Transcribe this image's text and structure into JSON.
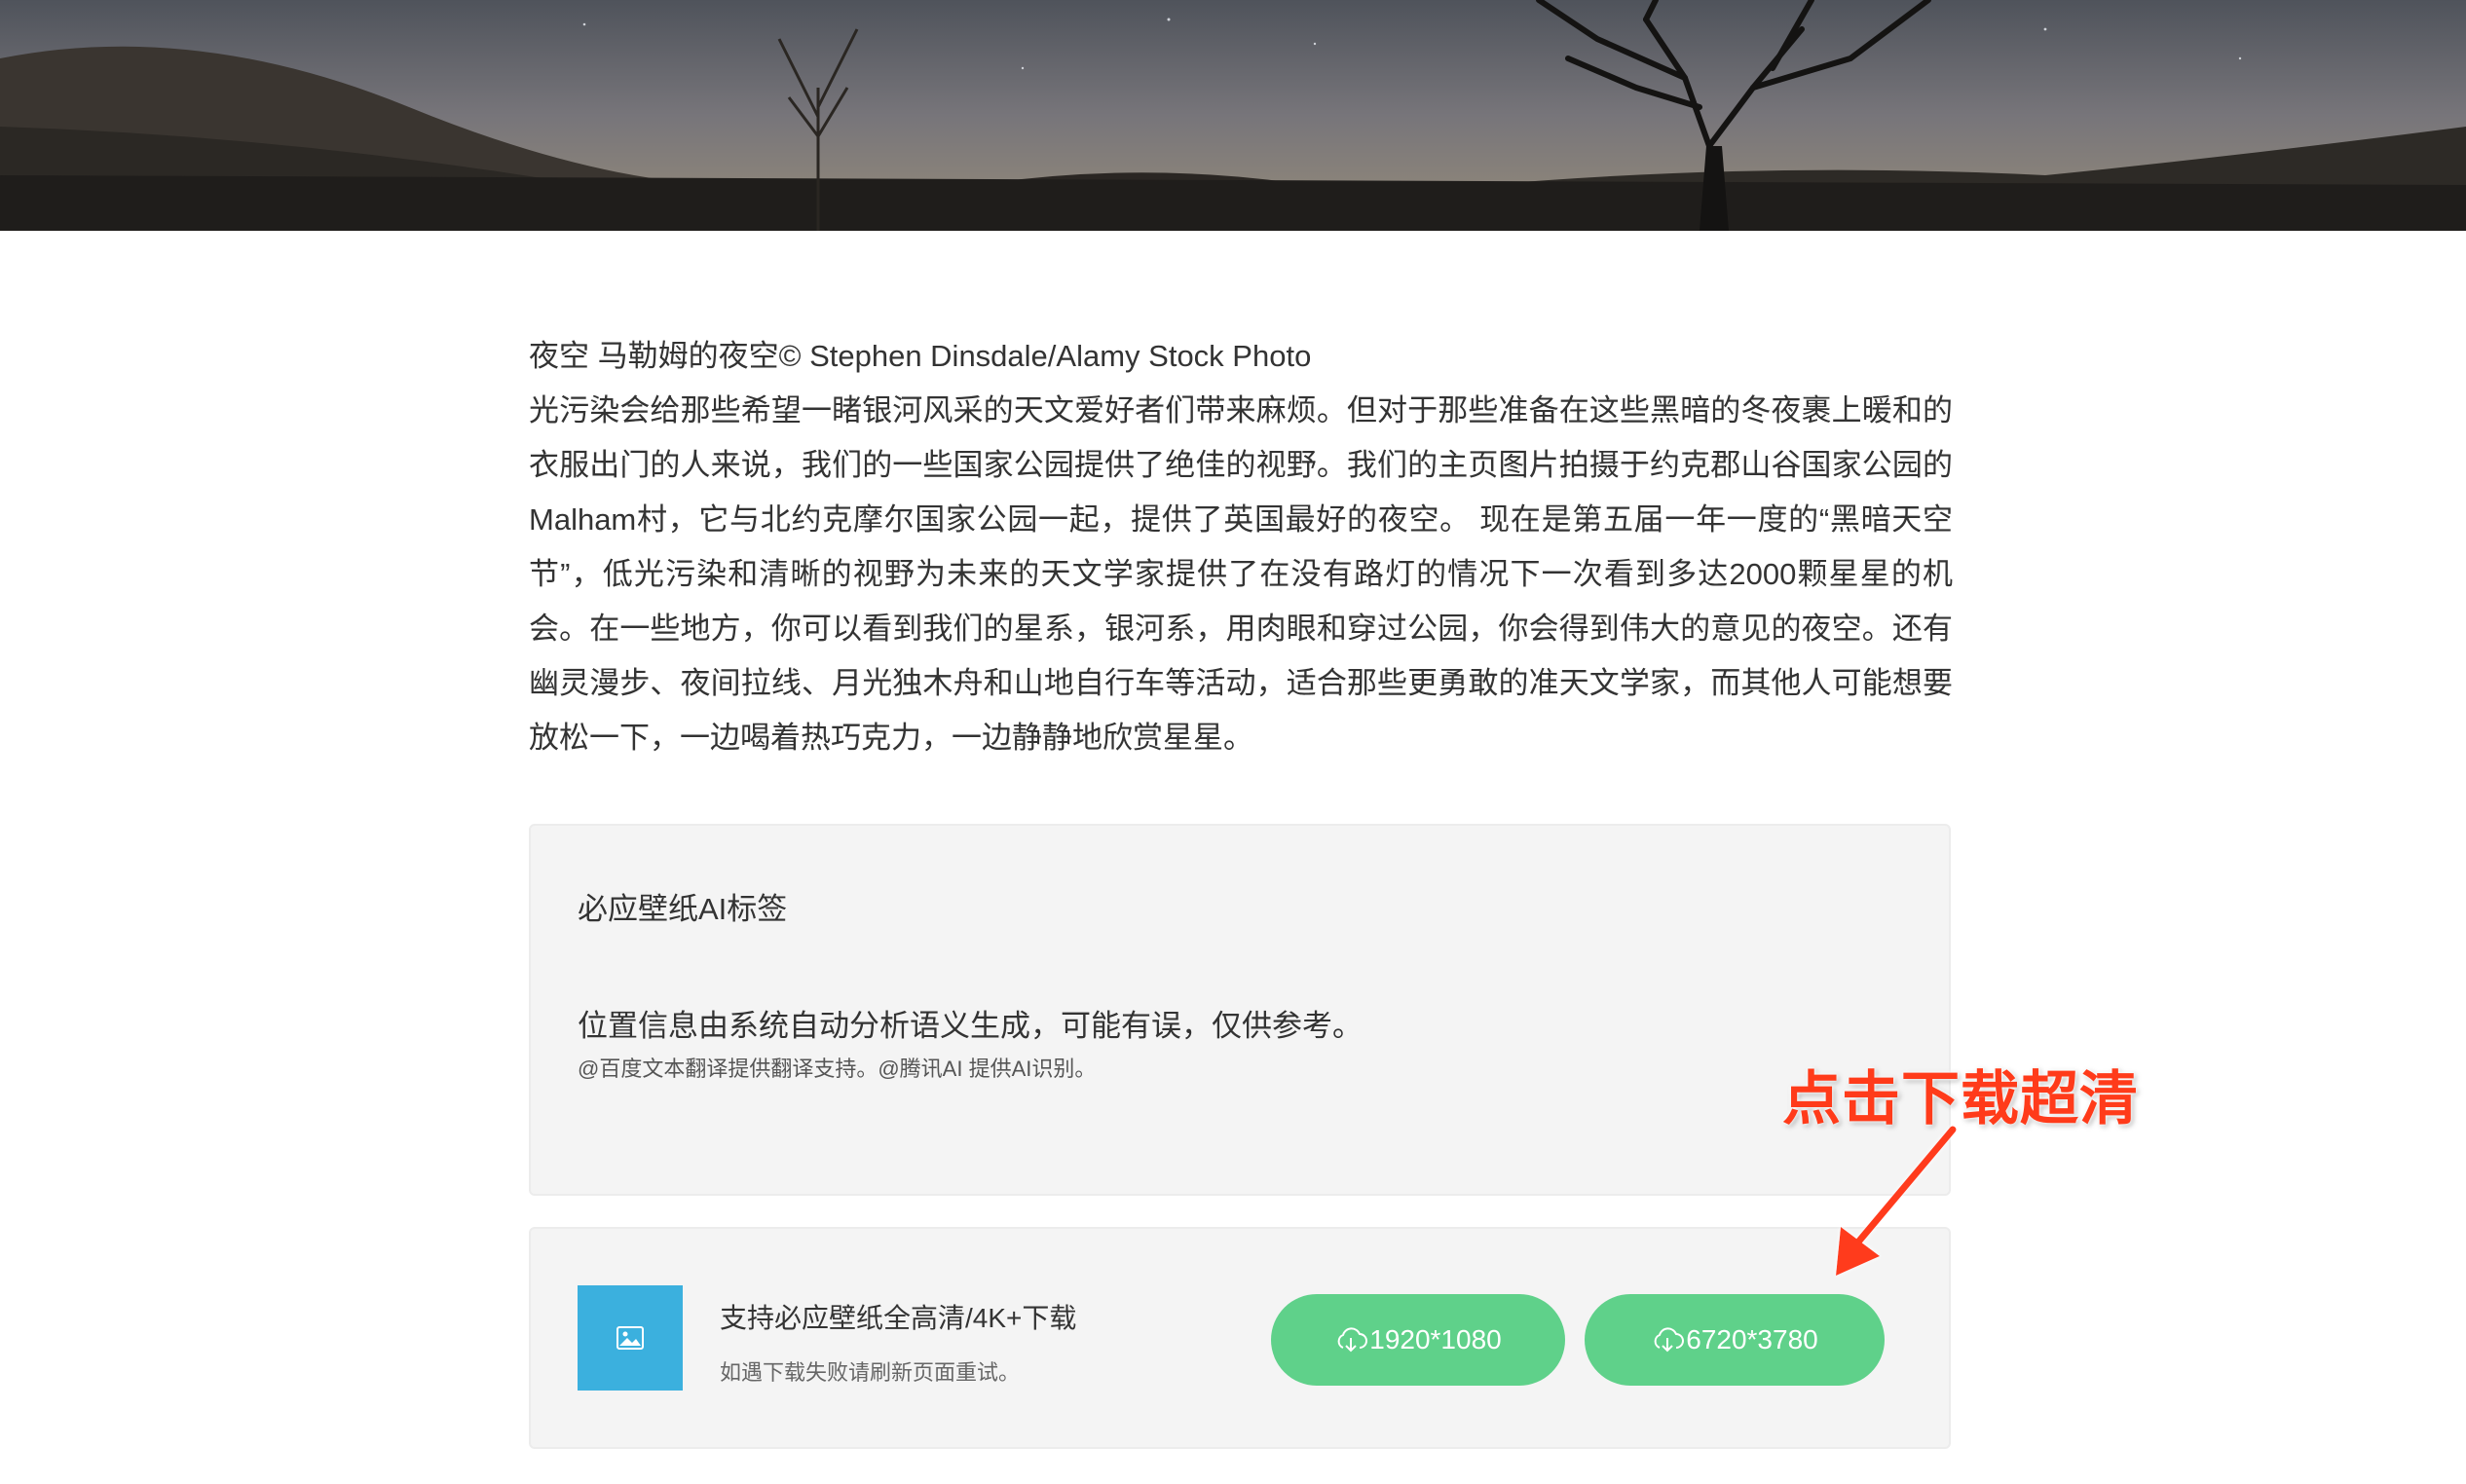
{
  "hero": {
    "alt": "Night sky over Malham with silhouetted tree"
  },
  "article": {
    "caption": "夜空 马勒姆的夜空© Stephen Dinsdale/Alamy Stock Photo",
    "body": "光污染会给那些希望一睹银河风采的天文爱好者们带来麻烦。但对于那些准备在这些黑暗的冬夜裹上暖和的衣服出门的人来说，我们的一些国家公园提供了绝佳的视野。我们的主页图片拍摄于约克郡山谷国家公园的Malham村，它与北约克摩尔国家公园一起，提供了英国最好的夜空。 现在是第五届一年一度的“黑暗天空节”，低光污染和清晰的视野为未来的天文学家提供了在没有路灯的情况下一次看到多达2000颗星星的机会。在一些地方，你可以看到我们的星系，银河系，用肉眼和穿过公园，你会得到伟大的意见的夜空。还有幽灵漫步、夜间拉线、月光独木舟和山地自行车等活动，适合那些更勇敢的准天文学家，而其他人可能想要放松一下，一边喝着热巧克力，一边静静地欣赏星星。"
  },
  "tags_panel": {
    "title": "必应壁纸AI标签",
    "note": "位置信息由系统自动分析语义生成，可能有误，仅供参考。",
    "credit": "@百度文本翻译提供翻译支持。@腾讯AI 提供AI识别。"
  },
  "download_panel": {
    "icon": "image-icon",
    "title": "支持必应壁纸全高清/4K+下载",
    "hint": "如遇下载失败请刷新页面重试。",
    "button_1080": "1920*1080",
    "button_uhd": "6720*3780",
    "button_icon": "cloud-download-icon",
    "button_color": "#5fd18a",
    "icon_bg": "#3bb0de"
  },
  "annotation": {
    "text": "点击下载超清",
    "color": "#ff3b1a"
  }
}
